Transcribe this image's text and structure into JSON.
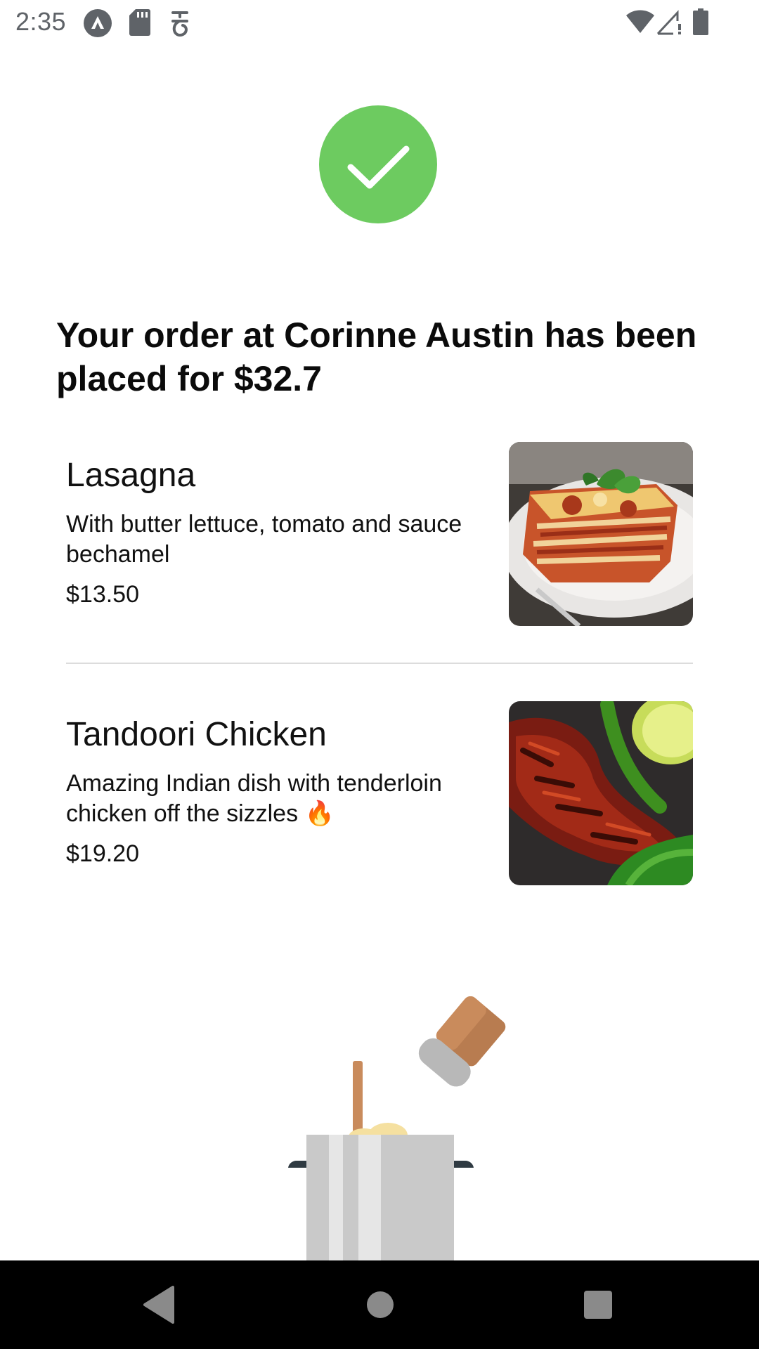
{
  "status_bar": {
    "time": "2:35",
    "icons": [
      "app-a-icon",
      "sd-card-icon",
      "accessibility-icon",
      "wifi-icon",
      "signal-icon",
      "battery-icon"
    ]
  },
  "order": {
    "title": "Your order at Corinne Austin has been placed for $32.7",
    "success_color": "#6dcb60"
  },
  "items": [
    {
      "name": "Lasagna",
      "description": "With butter lettuce, tomato and sauce bechamel",
      "price": "$13.50",
      "image": "lasagna-photo"
    },
    {
      "name": "Tandoori Chicken",
      "description": "Amazing Indian dish with tenderloin chicken off the sizzles 🔥",
      "price": "$19.20",
      "image": "tandoori-chicken-photo"
    }
  ],
  "nav_bar": {
    "buttons": [
      "back-icon",
      "home-icon",
      "recents-icon"
    ]
  }
}
